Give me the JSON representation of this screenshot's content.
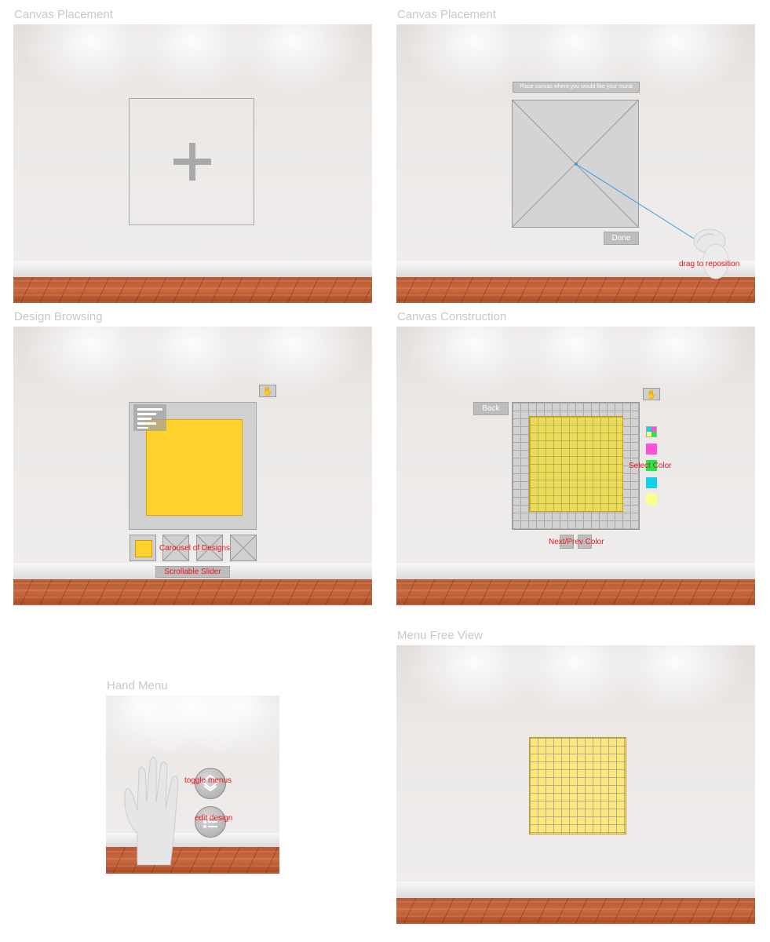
{
  "frames": {
    "canvas_placement_1": {
      "title": "Canvas Placement"
    },
    "canvas_placement_2": {
      "title": "Canvas Placement",
      "prompt": "Place canvas where you would like your mural",
      "done_label": "Done",
      "drag_hint": "drag to reposition"
    },
    "design_browsing": {
      "title": "Design Browsing",
      "carousel_label": "Carousel of Designs",
      "slider_label": "Scrollable Slider"
    },
    "canvas_construction": {
      "title": "Canvas Construction",
      "back_label": "Back",
      "select_color_label": "Select Color",
      "next_prev_label": "Next/Prev Color"
    },
    "hand_menu": {
      "title": "Hand Menu",
      "toggle_label": "toggle menus",
      "edit_label": "edit design"
    },
    "menu_free_view": {
      "title": "Menu Free View"
    }
  },
  "colors": {
    "design_yellow": "#ffd22e",
    "canvas_yellow": "#e8dc5a",
    "grid_yellow": "#fbe77a",
    "swatches": [
      "#ff4fd8",
      "#22e84a",
      "#10d2e6",
      "#ffff88"
    ]
  },
  "icons": [
    "plus-icon",
    "hand-icon",
    "menu-lines-icon",
    "layers-icon",
    "list-icon"
  ]
}
